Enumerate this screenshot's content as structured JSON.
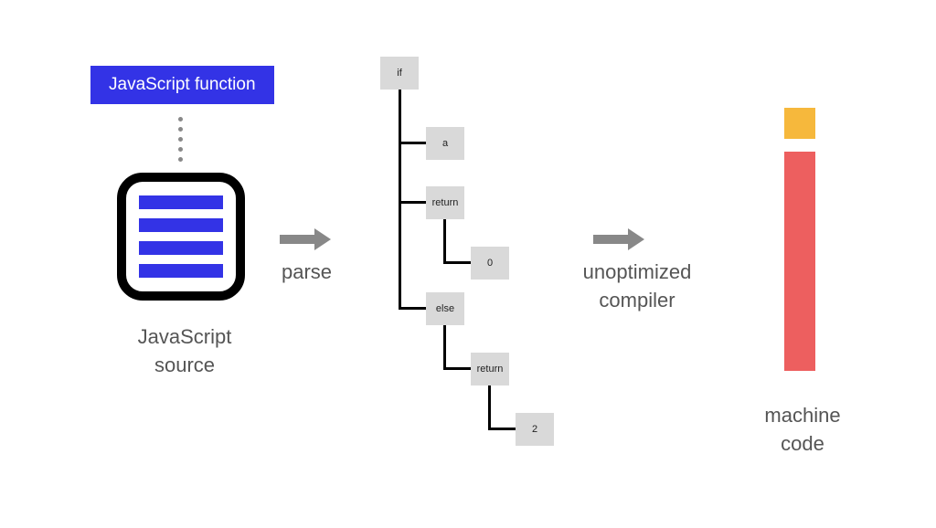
{
  "badge": {
    "label": "JavaScript function"
  },
  "source": {
    "label": "JavaScript\nsource"
  },
  "parse": {
    "label": "parse"
  },
  "unoptimized": {
    "label": "unoptimized\ncompiler"
  },
  "machine": {
    "label": "machine\ncode"
  },
  "tree": {
    "if": "if",
    "a": "a",
    "return1": "return",
    "zero": "0",
    "else": "else",
    "return2": "return",
    "two": "2"
  }
}
